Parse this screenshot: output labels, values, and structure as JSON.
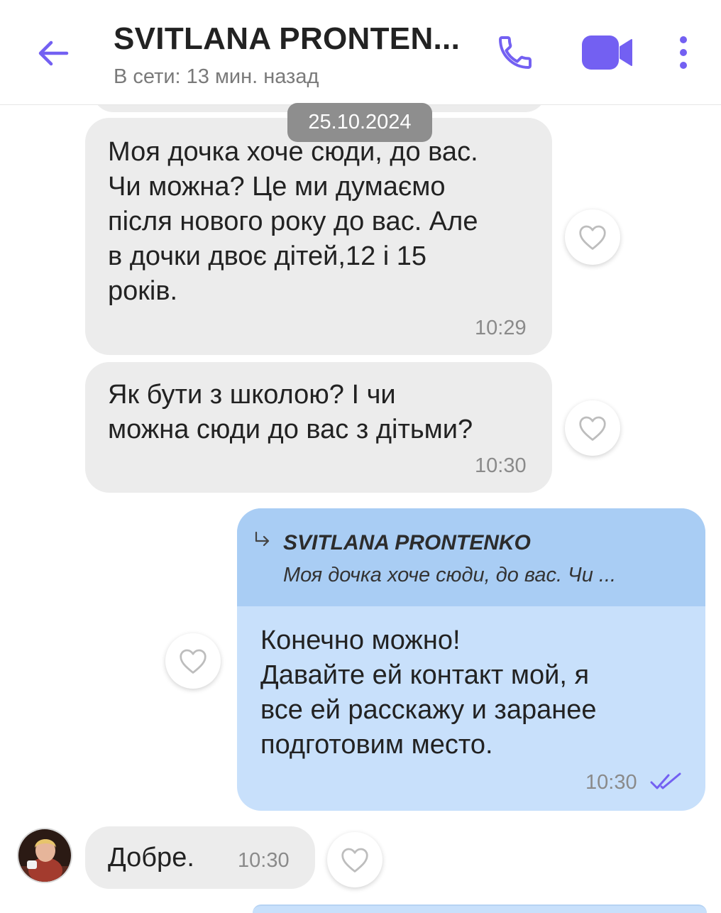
{
  "header": {
    "title": "SVITLANA PRONTEN...",
    "status": "В сети: 13 мин. назад"
  },
  "date_separator": "25.10.2024",
  "messages": [
    {
      "direction": "incoming",
      "text": "Моя дочка хоче сюди, до вас. Чи можна? Це ми думаємо після нового року до вас. Але в дочки двоє дітей,12 і 15 років.",
      "lines": [
        "Моя дочка хоче сюди, до вас.",
        "Чи можна? Це ми думаємо",
        "після нового року до вас. Але",
        "в дочки двоє дітей,12 і 15",
        "років."
      ],
      "time": "10:29"
    },
    {
      "direction": "incoming",
      "text": "Як бути з школою? І чи можна сюди до вас з дітьми?",
      "lines": [
        "Як бути з школою? І чи",
        "можна сюди до вас з дітьми?"
      ],
      "time": "10:30"
    },
    {
      "direction": "outgoing",
      "reply_to": {
        "name": "SVITLANA PRONTENKO",
        "text": "Моя дочка хоче сюди, до вас. Чи ..."
      },
      "lines": [
        "Конечно можно!",
        "Давайте ей контакт мой, я",
        "все ей расскажу и заранее",
        "подготовим место."
      ],
      "time": "10:30",
      "status": "read"
    },
    {
      "direction": "incoming",
      "text": "Добре.",
      "time": "10:30"
    }
  ],
  "colors": {
    "accent": "#7360f2",
    "incoming_bubble": "#ececec",
    "outgoing_bubble": "#c8e0fb",
    "quote_block": "#a9cdf4"
  },
  "icons": [
    "back-arrow-icon",
    "phone-icon",
    "video-camera-icon",
    "more-vertical-icon",
    "heart-icon",
    "reply-arrow-icon",
    "double-check-icon"
  ]
}
